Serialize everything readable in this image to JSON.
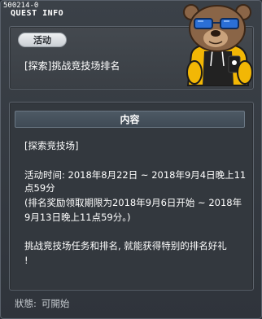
{
  "window": {
    "quest_id": "500214-0",
    "title": "QUEST INFO"
  },
  "summary": {
    "type_label": "活动",
    "quest_name": "[探索]挑战竞技场排名"
  },
  "content": {
    "header": "内容",
    "lines": [
      "[探索竞技场]",
      "活动时间: 2018年8月22日 ~ 2018年9月4日晚上11",
      "点59分",
      "(排名奖励领取期限为2018年9月6日开始 ~ 2018年",
      "9月13日晚上11点59分。)",
      "挑战竞技场任务和排名, 就能获得特别的排名好礼",
      "!"
    ]
  },
  "status": {
    "label": "狀態:",
    "value": "可開始"
  },
  "colors": {
    "window_bg": "#2f343b",
    "panel_border": "#5d646d",
    "header_bg": "#4d5964",
    "mascot_fur": "#8a6547",
    "mascot_hoodie": "#f2b705"
  }
}
